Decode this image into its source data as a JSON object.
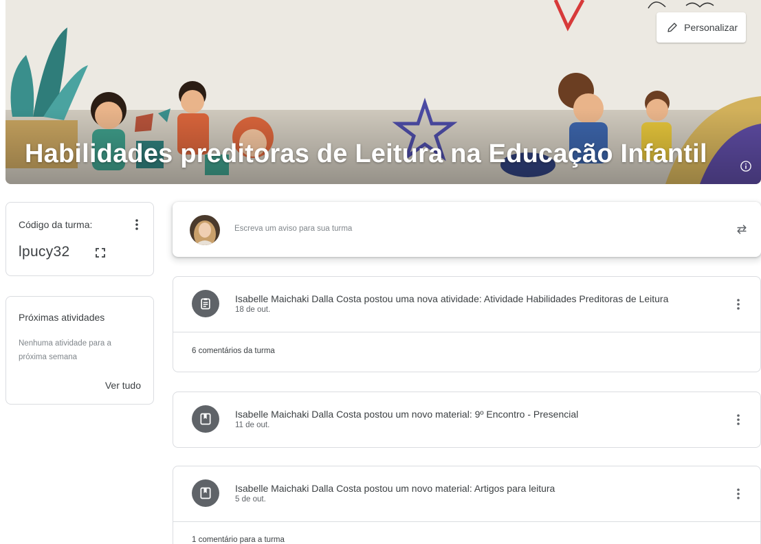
{
  "banner": {
    "title": "Habilidades preditoras de Leitura na Educação Infantil",
    "customize_label": "Personalizar",
    "info_icon": "info-icon",
    "edit_icon": "pencil-icon"
  },
  "class_code": {
    "label": "Código da turma:",
    "value": "lpucy32",
    "menu_icon": "more-vert-icon",
    "expand_icon": "fullscreen-icon"
  },
  "upcoming": {
    "title": "Próximas atividades",
    "empty_text": "Nenhuma atividade para a próxima semana",
    "view_all": "Ver tudo"
  },
  "compose": {
    "placeholder": "Escreva um aviso para sua turma",
    "repost_icon": "repost-icon"
  },
  "posts": [
    {
      "icon": "assignment-icon",
      "title": "Isabelle Maichaki Dalla Costa postou uma nova atividade: Atividade Habilidades Preditoras de Leitura",
      "date": "18 de out.",
      "comments": "6 comentários da turma"
    },
    {
      "icon": "material-icon",
      "title": "Isabelle Maichaki Dalla Costa postou um novo material: 9º Encontro - Presencial",
      "date": "11 de out."
    },
    {
      "icon": "material-icon",
      "title": "Isabelle Maichaki Dalla Costa postou um novo material: Artigos para leitura",
      "date": "5 de out.",
      "comments": "1 comentário para a turma"
    }
  ],
  "colors": {
    "icon_bg": "#5f6368",
    "border": "#dadce0",
    "text": "#3c4043",
    "muted": "#80868b"
  }
}
